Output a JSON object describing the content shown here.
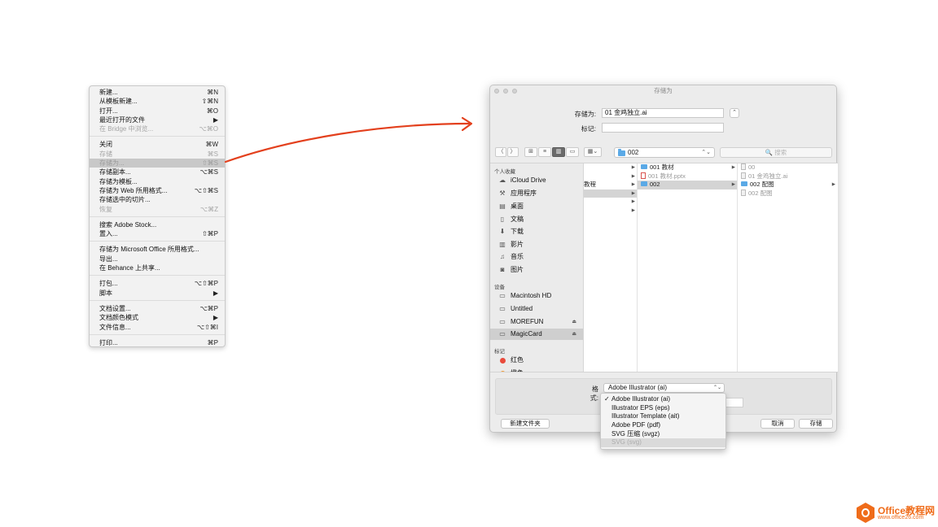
{
  "file_menu": {
    "items": [
      {
        "label": "新建...",
        "shortcut": "⌘N"
      },
      {
        "label": "从模板新建...",
        "shortcut": "⇧⌘N"
      },
      {
        "label": "打开...",
        "shortcut": "⌘O"
      },
      {
        "label": "最近打开的文件",
        "shortcut": "▶"
      },
      {
        "label": "在 Bridge 中浏览...",
        "shortcut": "⌥⌘O"
      },
      {
        "label": "关闭",
        "shortcut": "⌘W"
      },
      {
        "label": "存储",
        "shortcut": "⌘S"
      },
      {
        "label": "存储为...",
        "shortcut": "⇧⌘S"
      },
      {
        "label": "存储副本...",
        "shortcut": "⌥⌘S"
      },
      {
        "label": "存储为模板...",
        "shortcut": ""
      },
      {
        "label": "存储为 Web 所用格式...",
        "shortcut": "⌥⇧⌘S"
      },
      {
        "label": "存储选中的切片...",
        "shortcut": ""
      },
      {
        "label": "恢复",
        "shortcut": "⌥⌘Z"
      },
      {
        "label": "搜索 Adobe Stock...",
        "shortcut": ""
      },
      {
        "label": "置入...",
        "shortcut": "⇧⌘P"
      },
      {
        "label": "存储为 Microsoft Office 所用格式...",
        "shortcut": ""
      },
      {
        "label": "导出...",
        "shortcut": ""
      },
      {
        "label": "在 Behance 上共享...",
        "shortcut": ""
      },
      {
        "label": "打包...",
        "shortcut": "⌥⇧⌘P"
      },
      {
        "label": "脚本",
        "shortcut": "▶"
      },
      {
        "label": "文档设置...",
        "shortcut": "⌥⌘P"
      },
      {
        "label": "文档颜色模式",
        "shortcut": "▶"
      },
      {
        "label": "文件信息...",
        "shortcut": "⌥⇧⌘I"
      },
      {
        "label": "打印...",
        "shortcut": "⌘P"
      }
    ]
  },
  "dialog": {
    "title": "存储为",
    "save_as_label": "存储为:",
    "save_as_value": "01 金鸡独立.ai",
    "tags_label": "标记:",
    "tags_value": "",
    "expand_glyph": "⌃",
    "nav_back": "〈",
    "nav_forward": "〉",
    "view_icon_glyph": "⊞",
    "view_list_glyph": "≡",
    "view_column_glyph": "▥",
    "view_cover_glyph": "▭",
    "arrange_glyph": "▦⌄",
    "path_folder": "002",
    "path_arrow": "⌃⌄",
    "search_placeholder": "🔍 搜索",
    "sidebar": {
      "favorites_head": "个人收藏",
      "favorites": [
        {
          "label": "iCloud Drive",
          "icon": "☁"
        },
        {
          "label": "应用程序",
          "icon": "⚒"
        },
        {
          "label": "桌面",
          "icon": "▤"
        },
        {
          "label": "文稿",
          "icon": "▯"
        },
        {
          "label": "下载",
          "icon": "⬇"
        },
        {
          "label": "影片",
          "icon": "▥"
        },
        {
          "label": "音乐",
          "icon": "♫"
        },
        {
          "label": "图片",
          "icon": "◙"
        }
      ],
      "devices_head": "设备",
      "devices": [
        {
          "label": "Macintosh HD",
          "icon": "▭",
          "eject": ""
        },
        {
          "label": "Untitled",
          "icon": "▭",
          "eject": ""
        },
        {
          "label": "MOREFUN",
          "icon": "▭",
          "eject": "⏏"
        },
        {
          "label": "MagicCard",
          "icon": "▭",
          "eject": "⏏"
        }
      ],
      "tags_head": "标记",
      "tags": [
        {
          "label": "红色",
          "color": "#e94b3c"
        },
        {
          "label": "橙色",
          "color": "#f39c33"
        }
      ]
    },
    "columns": {
      "col1": [
        "",
        "",
        "教程",
        "",
        "",
        ""
      ],
      "col2": [
        {
          "label": "001 教材",
          "kind": "folder"
        },
        {
          "label": "001 教材.pptx",
          "kind": "ppt"
        },
        {
          "label": "002",
          "kind": "folder"
        }
      ],
      "col3": [
        {
          "label": "00",
          "kind": "doc"
        },
        {
          "label": "01 金鸡独立.ai",
          "kind": "doc"
        },
        {
          "label": "002 配图",
          "kind": "folder"
        },
        {
          "label": "002 配图",
          "kind": "doc"
        }
      ]
    },
    "format_label": "格式:",
    "format_value": "Adobe Illustrator (ai)",
    "format_arrow": "⌃⌄",
    "format_options": [
      {
        "label": "Adobe Illustrator (ai)",
        "check": "✓"
      },
      {
        "label": "Illustrator EPS (eps)",
        "check": ""
      },
      {
        "label": "Illustrator Template (ait)",
        "check": ""
      },
      {
        "label": "Adobe PDF (pdf)",
        "check": ""
      },
      {
        "label": "SVG 压缩 (svgz)",
        "check": ""
      },
      {
        "label": "SVG (svg)",
        "check": ""
      }
    ],
    "new_folder_label": "新建文件夹",
    "cancel_label": "取消",
    "save_label": "存储"
  },
  "watermark": {
    "line1": "Office教程网",
    "line2": "www.office26.com"
  },
  "colors": {
    "arrow": "#e3401d",
    "watermark": "#ef6c1a",
    "folder": "#5aa9e6"
  }
}
